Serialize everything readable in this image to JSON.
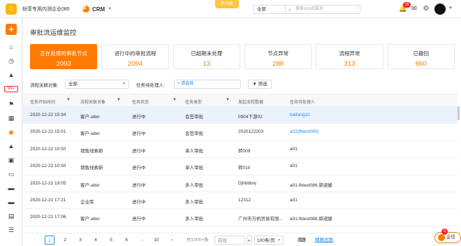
{
  "topbar": {
    "logo_glyph": "☺",
    "company": "纷享专用内测企业085",
    "app_name": "CRM",
    "new_feature": "新功能",
    "scope": "全部",
    "search_placeholder": "搜索crm且要多",
    "notification_count": "28"
  },
  "sidebar": {
    "add": "+",
    "badge": "99+"
  },
  "page": {
    "title": "审批流运维监控",
    "cards": [
      {
        "label": "正在处理的审批节点",
        "value": "2093",
        "active": true
      },
      {
        "label": "进行中的审批流程",
        "value": "2094",
        "active": false
      },
      {
        "label": "已超期未处理",
        "value": "13",
        "active": false
      },
      {
        "label": "节点异常",
        "value": "288",
        "active": false
      },
      {
        "label": "流程异常",
        "value": "313",
        "active": false
      },
      {
        "label": "已撤回",
        "value": "660",
        "active": false
      }
    ],
    "filters": {
      "object_label": "流程关联对象:",
      "object_value": "全部",
      "handler_label": "任务待处理人:",
      "handler_placeholder": "+ 请选择",
      "filter_button": "筛选"
    }
  },
  "table": {
    "columns": [
      "任务开始时间",
      "流程关联对象",
      "任务状态",
      "任务类型",
      "发起流程数据",
      "任务待处理人"
    ],
    "rows": [
      [
        "2020-12-22 15:34",
        "客户-alter",
        "进行中",
        "会签审批",
        "0904下游02",
        "baifang10"
      ],
      [
        "2020-12-22 15:01",
        "客户-alter",
        "进行中",
        "会签审批",
        "2020122203",
        "a02(fktest085)"
      ],
      [
        "2020-12-22 10:50",
        "销售线索新",
        "进行中",
        "单人审批",
        "转009",
        "a01"
      ],
      [
        "2020-12-22 10:50",
        "销售线索新",
        "进行中",
        "单人审批",
        "转010",
        "a01"
      ],
      [
        "2020-12-21 19:05",
        "客户-alter",
        "进行中",
        "多人审批",
        "Djhbbbnj",
        "a01-fktest086,郭淑媛"
      ],
      [
        "2020-12-21 17:21",
        "企业库",
        "进行中",
        "多人审批",
        "12312",
        "a01"
      ],
      [
        "2020-12-21 17:06",
        "客户-alter",
        "进行中",
        "多人审批",
        "广州市万帆贸易有限...",
        "a01-fktest086,郭淑媛"
      ]
    ]
  },
  "pager": {
    "prev": "‹",
    "pages": [
      "1",
      "2",
      "3",
      "4",
      "5",
      "6",
      "···",
      "10"
    ],
    "next": "›",
    "total": "约1000+条",
    "goto": "前往",
    "page_size": "100条/页",
    "precise_total": "精确总数"
  },
  "chat": {
    "label": "企信",
    "badge": "6"
  }
}
